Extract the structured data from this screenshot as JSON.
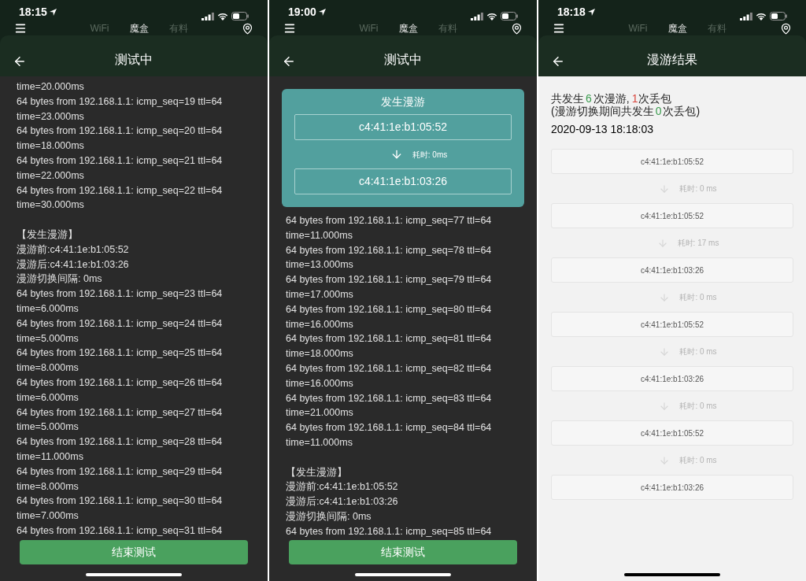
{
  "screens": [
    {
      "kind": "log",
      "status_bar": {
        "time": "18:15"
      },
      "nav_tabs": [
        {
          "label": "WiFi",
          "selected": false
        },
        {
          "label": "魔盒",
          "selected": true
        },
        {
          "label": "有料",
          "selected": false
        }
      ],
      "header": {
        "title": "测试中"
      },
      "log_sections": [
        [
          "time=20.000ms",
          "64 bytes from 192.168.1.1: icmp_seq=19 ttl=64",
          "time=23.000ms",
          "64 bytes from 192.168.1.1: icmp_seq=20 ttl=64",
          "time=18.000ms",
          "64 bytes from 192.168.1.1: icmp_seq=21 ttl=64",
          "time=22.000ms",
          "64 bytes from 192.168.1.1: icmp_seq=22 ttl=64",
          "time=30.000ms"
        ],
        [
          "【发生漫游】",
          "漫游前:c4:41:1e:b1:05:52",
          "漫游后:c4:41:1e:b1:03:26",
          "漫游切换间隔: 0ms",
          "64 bytes from 192.168.1.1: icmp_seq=23 ttl=64",
          "time=6.000ms",
          "64 bytes from 192.168.1.1: icmp_seq=24 ttl=64",
          "time=5.000ms",
          "64 bytes from 192.168.1.1: icmp_seq=25 ttl=64",
          "time=8.000ms",
          "64 bytes from 192.168.1.1: icmp_seq=26 ttl=64",
          "time=6.000ms",
          "64 bytes from 192.168.1.1: icmp_seq=27 ttl=64",
          "time=5.000ms",
          "64 bytes from 192.168.1.1: icmp_seq=28 ttl=64",
          "time=11.000ms",
          "64 bytes from 192.168.1.1: icmp_seq=29 ttl=64",
          "time=8.000ms",
          "64 bytes from 192.168.1.1: icmp_seq=30 ttl=64",
          "time=7.000ms",
          "64 bytes from 192.168.1.1: icmp_seq=31 ttl=64"
        ]
      ],
      "end_button": "结束测试"
    },
    {
      "kind": "log",
      "status_bar": {
        "time": "19:00"
      },
      "nav_tabs": [
        {
          "label": "WiFi",
          "selected": false
        },
        {
          "label": "魔盒",
          "selected": true
        },
        {
          "label": "有料",
          "selected": false
        }
      ],
      "header": {
        "title": "测试中"
      },
      "roam_dialog": {
        "title": "发生漫游",
        "from_mac": "c4:41:1e:b1:05:52",
        "elapsed": "耗时: 0ms",
        "to_mac": "c4:41:1e:b1:03:26"
      },
      "log_sections": [
        [
          "64 bytes from 192.168.1.1: icmp_seq=77 ttl=64",
          "time=11.000ms",
          "64 bytes from 192.168.1.1: icmp_seq=78 ttl=64",
          "time=13.000ms",
          "64 bytes from 192.168.1.1: icmp_seq=79 ttl=64",
          "time=17.000ms",
          "64 bytes from 192.168.1.1: icmp_seq=80 ttl=64",
          "time=16.000ms",
          "64 bytes from 192.168.1.1: icmp_seq=81 ttl=64",
          "time=18.000ms",
          "64 bytes from 192.168.1.1: icmp_seq=82 ttl=64",
          "time=16.000ms",
          "64 bytes from 192.168.1.1: icmp_seq=83 ttl=64",
          "time=21.000ms",
          "64 bytes from 192.168.1.1: icmp_seq=84 ttl=64",
          "time=11.000ms"
        ],
        [
          "【发生漫游】",
          "漫游前:c4:41:1e:b1:05:52",
          "漫游后:c4:41:1e:b1:03:26",
          "漫游切换间隔: 0ms",
          "64 bytes from 192.168.1.1: icmp_seq=85 ttl=64"
        ]
      ],
      "end_button": "结束测试"
    },
    {
      "kind": "result",
      "status_bar": {
        "time": "18:18"
      },
      "nav_tabs": [
        {
          "label": "WiFi",
          "selected": false
        },
        {
          "label": "魔盒",
          "selected": true
        },
        {
          "label": "有料",
          "selected": false
        }
      ],
      "header": {
        "title": "漫游结果"
      },
      "summary": {
        "before": "共发生",
        "roams": "6",
        "middle": "次漫游,",
        "drops": "1",
        "after": "次丢包"
      },
      "summary_detail": {
        "before": "(漫游切换期间共发生",
        "drops": "0",
        "after": "次丢包)"
      },
      "date": "2020-09-13 18:18:03",
      "hops": [
        {
          "mac": "c4:41:1e:b1:05:52",
          "elapsed": "耗时: 0 ms"
        },
        {
          "mac": "c4:41:1e:b1:05:52",
          "elapsed": "耗时: 17 ms"
        },
        {
          "mac": "c4:41:1e:b1:03:26",
          "elapsed": "耗时: 0 ms"
        },
        {
          "mac": "c4:41:1e:b1:05:52",
          "elapsed": "耗时: 0 ms"
        },
        {
          "mac": "c4:41:1e:b1:03:26",
          "elapsed": "耗时: 0 ms"
        },
        {
          "mac": "c4:41:1e:b1:05:52",
          "elapsed": "耗时: 0 ms"
        },
        {
          "mac": "c4:41:1e:b1:03:26"
        }
      ]
    }
  ]
}
